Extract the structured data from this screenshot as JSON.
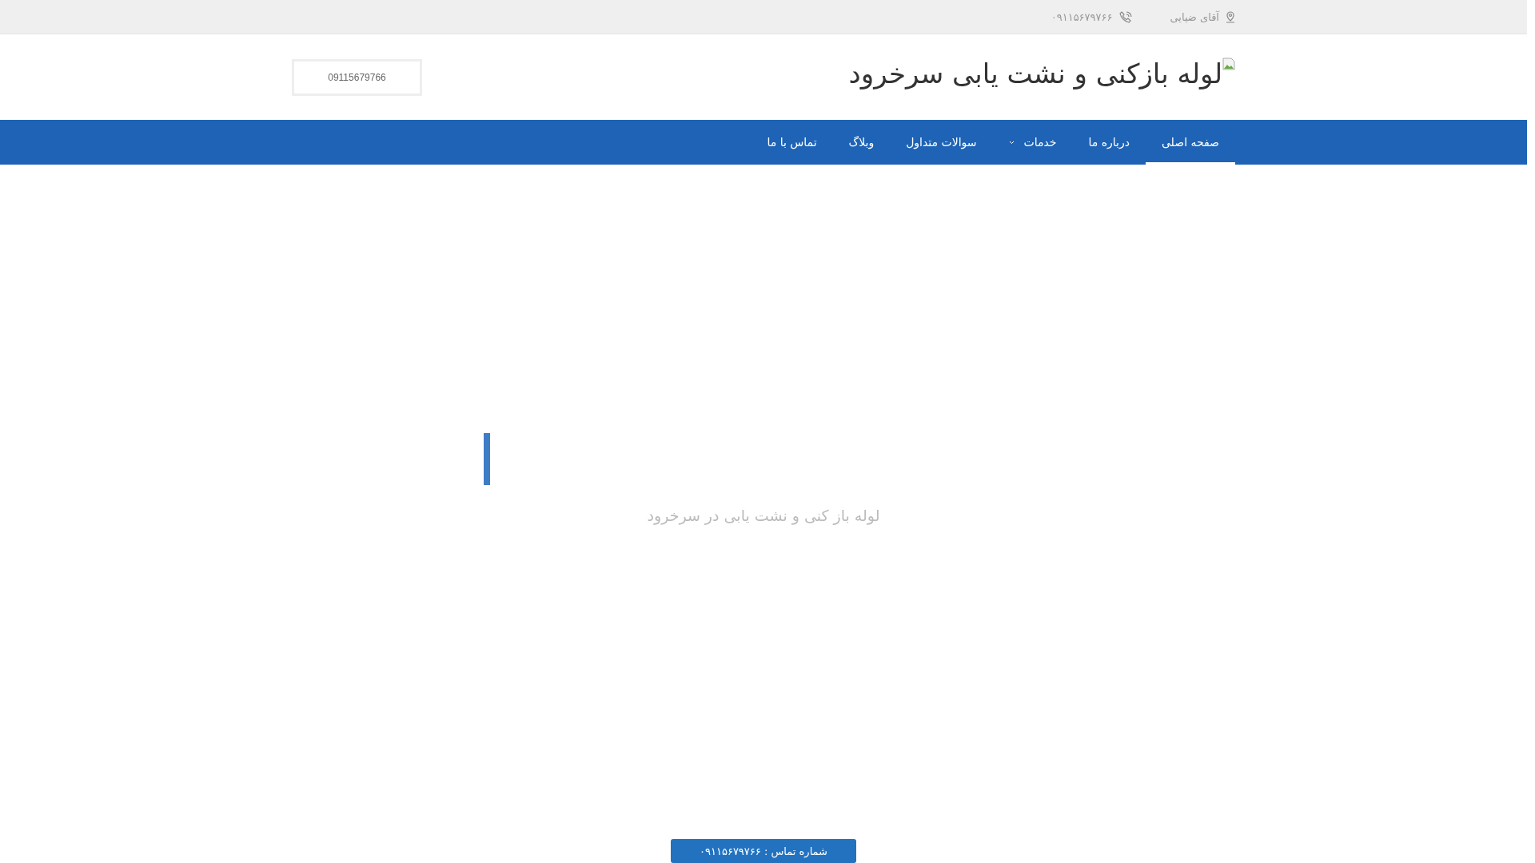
{
  "top_bar": {
    "name": "آقای ضیایی",
    "phone": "۰۹۱۱۵۶۷۹۷۶۶"
  },
  "header": {
    "logo_text": "لوله بازکنی و نشت یابی سرخرود",
    "phone_button": "09115679766"
  },
  "nav": [
    {
      "label": "صفحه اصلی",
      "selected": true,
      "has_submenu": false
    },
    {
      "label": "درباره ما",
      "selected": false,
      "has_submenu": false
    },
    {
      "label": "خدمات",
      "selected": false,
      "has_submenu": true
    },
    {
      "label": "سوالات متداول",
      "selected": false,
      "has_submenu": false
    },
    {
      "label": "وبلاگ",
      "selected": false,
      "has_submenu": false
    },
    {
      "label": "تماس با ما",
      "selected": false,
      "has_submenu": false
    }
  ],
  "hero": {
    "subtitle": "لوله باز کنی و نشت یابی در سرخرود",
    "call_button": "شماره تماس : ۰۹۱۱۵۶۷۹۷۶۶"
  }
}
